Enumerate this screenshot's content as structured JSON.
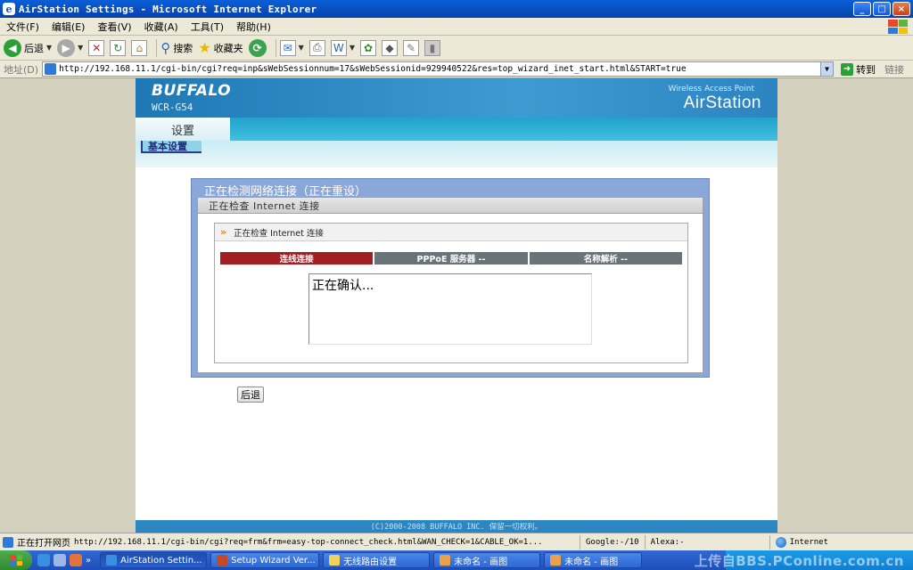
{
  "window": {
    "title": "AirStation Settings - Microsoft Internet Explorer",
    "buttons": {
      "min": "_",
      "max": "□",
      "close": "×"
    }
  },
  "menu": [
    "文件(F)",
    "编辑(E)",
    "查看(V)",
    "收藏(A)",
    "工具(T)",
    "帮助(H)"
  ],
  "toolbar": {
    "back_label": "后退",
    "search_label": "搜索",
    "favorites_label": "收藏夹"
  },
  "address": {
    "label": "地址(D)",
    "url": "http://192.168.11.1/cgi-bin/cgi?req=inp&sWebSessionnum=17&sWebSessionid=929940522&res=top_wizard_inet_start.html&START=true",
    "go_label": "转到",
    "links_label": "链接"
  },
  "header": {
    "brand": "BUFFALO",
    "model": "WCR-G54",
    "product_sub": "Wireless Access Point",
    "product_name": "AirStation"
  },
  "nav": {
    "tab": "设置",
    "subtab": "基本设置"
  },
  "wizard": {
    "title": "正在检测网络连接（正在重设）",
    "subhead": "正在检查 Internet 连接",
    "check_title": "正在检查 Internet 连接",
    "steps": [
      {
        "label": "连线连接",
        "state": "active"
      },
      {
        "label": "PPPoE 服务器 --",
        "state": "pending"
      },
      {
        "label": "名称解析 --",
        "state": "pending"
      }
    ],
    "status_text": "正在确认..."
  },
  "back_button": "后退",
  "footer": "(C)2000-2008 BUFFALO INC. 保留一切权利。",
  "statusbar": {
    "text": "正在打开网页",
    "url": "http://192.168.11.1/cgi-bin/cgi?req=frm&frm=easy-top-connect_check.html&WAN_CHECK=1&CABLE_OK=1...",
    "google": "Google:-/10",
    "alexa": "Alexa:-",
    "zone": "Internet"
  },
  "taskbar": {
    "tasks": [
      {
        "label": "AirStation Settin...",
        "active": true
      },
      {
        "label": "Setup Wizard  Ver...",
        "active": false
      },
      {
        "label": "无线路由设置",
        "active": false
      },
      {
        "label": "未命名 - 画图",
        "active": false
      },
      {
        "label": "未命名 - 画图",
        "active": false
      }
    ],
    "watermark": "上传自BBS.PConline.com.cn"
  }
}
